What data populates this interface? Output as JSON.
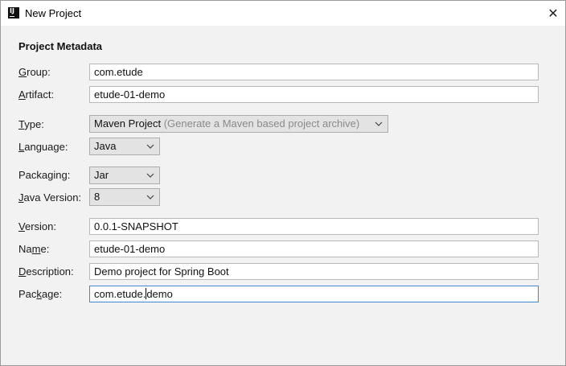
{
  "window": {
    "title": "New Project",
    "icon": "intellij-icon",
    "icon_text": "IJ",
    "close_icon": "close-icon"
  },
  "section_title": "Project Metadata",
  "fields": {
    "group": {
      "label_pre": "",
      "label_key": "G",
      "label_post": "roup:",
      "value": "com.etude"
    },
    "artifact": {
      "label_pre": "",
      "label_key": "A",
      "label_post": "rtifact:",
      "value": "etude-01-demo"
    },
    "type": {
      "label_pre": "",
      "label_key": "T",
      "label_post": "ype:",
      "value": "Maven Project",
      "hint": "(Generate a Maven based project archive)"
    },
    "language": {
      "label_pre": "",
      "label_key": "L",
      "label_post": "anguage:",
      "value": "Java"
    },
    "packaging": {
      "label_pre": "Packaging:",
      "label_key": "",
      "label_post": "",
      "value": "Jar"
    },
    "java_version": {
      "label_pre": "",
      "label_key": "J",
      "label_post": "ava Version:",
      "value": "8"
    },
    "version": {
      "label_pre": "",
      "label_key": "V",
      "label_post": "ersion:",
      "value": "0.0.1-SNAPSHOT"
    },
    "name": {
      "label_pre": "Na",
      "label_key": "m",
      "label_post": "e:",
      "value": "etude-01-demo"
    },
    "description": {
      "label_pre": "",
      "label_key": "D",
      "label_post": "escription:",
      "value": "Demo project for Spring Boot"
    },
    "package": {
      "label_pre": "Pac",
      "label_key": "k",
      "label_post": "age:",
      "value_before_caret": "com.etude.",
      "value_after_caret": "demo"
    }
  }
}
